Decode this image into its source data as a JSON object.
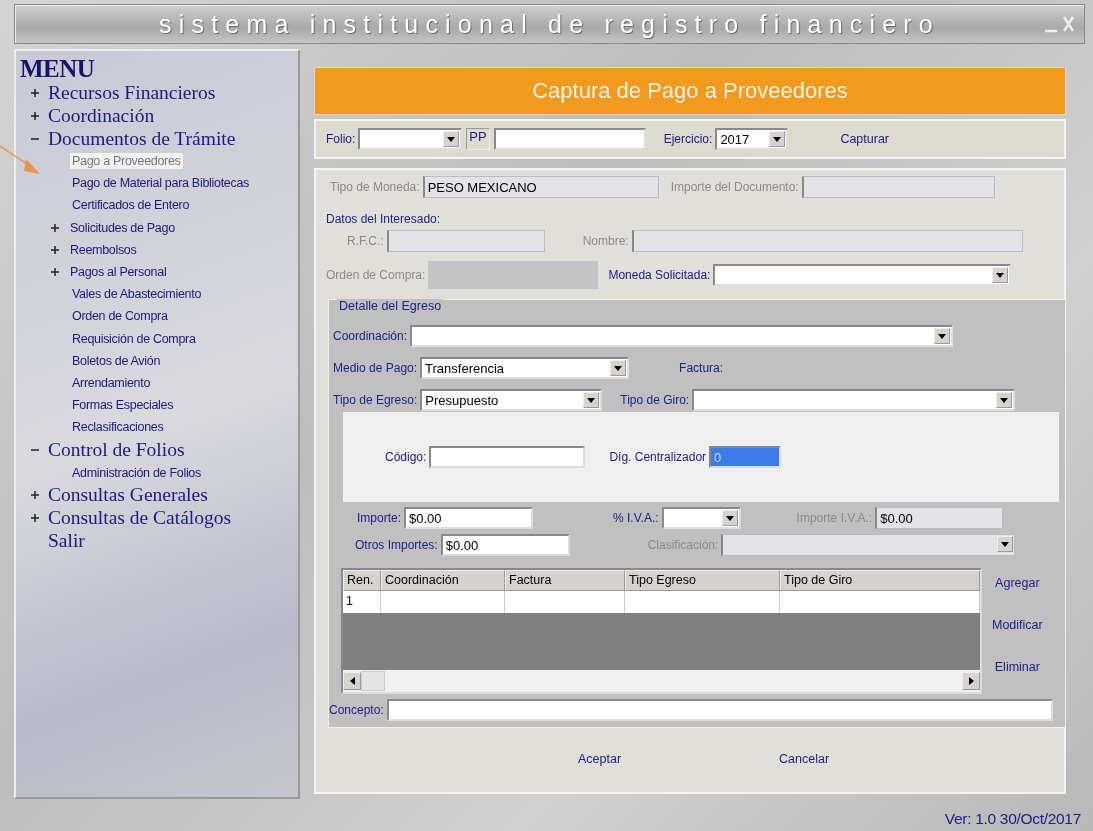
{
  "window": {
    "title": "sistema institucional de registro financiero"
  },
  "menu": {
    "title": "MENU",
    "items": [
      {
        "label": "Recursos Financieros",
        "kind": "folder",
        "expanded": false,
        "selected": false
      },
      {
        "label": "Coordinación",
        "kind": "folder",
        "expanded": false,
        "selected": false
      },
      {
        "label": "Documentos de Trámite",
        "kind": "folder",
        "expanded": true,
        "selected": false,
        "children": [
          {
            "label": "Pago a Proveedores",
            "kind": "leaf",
            "selected": true
          },
          {
            "label": "Pago de Material para Bibliotecas",
            "kind": "leaf",
            "selected": false
          },
          {
            "label": "Certificados de Entero",
            "kind": "leaf",
            "selected": false
          },
          {
            "label": "Solicitudes de Pago",
            "kind": "folder",
            "expanded": false,
            "selected": false
          },
          {
            "label": "Reembolsos",
            "kind": "folder",
            "expanded": false,
            "selected": false
          },
          {
            "label": "Pagos al Personal",
            "kind": "folder",
            "expanded": false,
            "selected": false
          },
          {
            "label": "Vales de Abastecimiento",
            "kind": "leaf",
            "selected": false
          },
          {
            "label": "Orden de Compra",
            "kind": "leaf",
            "selected": false
          },
          {
            "label": "Requisición de Compra",
            "kind": "leaf",
            "selected": false
          },
          {
            "label": "Boletos de Avión",
            "kind": "leaf",
            "selected": false
          },
          {
            "label": "Arrendamiento",
            "kind": "leaf",
            "selected": false
          },
          {
            "label": "Formas Especiales",
            "kind": "leaf",
            "selected": false
          },
          {
            "label": "Reclasificaciones",
            "kind": "leaf",
            "selected": false
          }
        ]
      },
      {
        "label": "Control de Folios",
        "kind": "folder",
        "expanded": true,
        "selected": false,
        "children": [
          {
            "label": "Administración de Folios",
            "kind": "leaf",
            "selected": false
          }
        ]
      },
      {
        "label": "Consultas Generales",
        "kind": "folder",
        "expanded": false,
        "selected": false
      },
      {
        "label": "Consultas de Catálogos",
        "kind": "folder",
        "expanded": false,
        "selected": false
      },
      {
        "label": "Salir",
        "kind": "leaf",
        "selected": false
      }
    ]
  },
  "form": {
    "title": "Captura de Pago a Proveedores",
    "toolbar": {
      "folio": {
        "label": "Folio:",
        "kind": "select",
        "disabled": false
      },
      "prefix": "PP",
      "number": {
        "kind": "text",
        "disabled": false
      },
      "ejercicio": {
        "label": "Ejercicio:",
        "kind": "select",
        "value": "2017",
        "disabled": false
      },
      "action": "Capturar"
    },
    "tipo_moneda": {
      "label": "Tipo de Moneda:",
      "kind": "text",
      "value": "PESO MEXICANO",
      "disabled": true
    },
    "importe_documento": {
      "label": "Importe del Documento:",
      "kind": "text",
      "disabled": true
    },
    "datos_interesado": "Datos del Interesado:",
    "rfc": {
      "label": "R.F.C.:",
      "kind": "text",
      "disabled": true
    },
    "nombre": {
      "label": "Nombre:",
      "kind": "text",
      "disabled": true
    },
    "orden_compra": {
      "label": "Orden de Compra:",
      "kind": "block",
      "disabled": true
    },
    "moneda_solicitada": {
      "label": "Moneda Solicitada:",
      "kind": "select",
      "disabled": false
    },
    "detalle": {
      "title": "Detalle del Egreso",
      "coordinacion": {
        "label": "Coordinación:",
        "kind": "select",
        "disabled": false
      },
      "medio_pago": {
        "label": "Medio de Pago:",
        "kind": "select",
        "value": "Transferencia",
        "disabled": false
      },
      "factura": "Factura:",
      "tipo_egreso": {
        "label": "Tipo de Egreso:",
        "kind": "select",
        "value": "Presupuesto",
        "disabled": false
      },
      "tipo_giro": {
        "label": "Tipo de Giro:",
        "kind": "select",
        "disabled": false
      },
      "codigo": {
        "label": "Código:",
        "kind": "text",
        "disabled": false
      },
      "centralizador": {
        "label": "Díg. Centralizador",
        "kind": "text",
        "value": "0",
        "disabled": false,
        "highlighted": true
      },
      "importe": {
        "label": "Importe:",
        "kind": "text",
        "value": "$0.00",
        "disabled": false
      },
      "iva": {
        "label": "% I.V.A.:",
        "kind": "select",
        "disabled": false
      },
      "importe_iva": {
        "label": "Importe I.V.A.:",
        "kind": "text",
        "value": "$0.00",
        "disabled": true
      },
      "otros_importes": {
        "label": "Otros Importes:",
        "kind": "text",
        "value": "$0.00",
        "disabled": false
      },
      "clasificacion": {
        "label": "Clasificación:",
        "kind": "select",
        "disabled": true
      },
      "table": {
        "columns": [
          "Ren.",
          "Coordinación",
          "Factura",
          "Tipo Egreso",
          "Tipo de Giro"
        ],
        "rows": [
          {
            "cells": [
              "1"
            ]
          }
        ]
      },
      "actions": [
        "Agregar",
        "Modificar",
        "Eliminar"
      ],
      "concepto": {
        "label": "Concepto:",
        "kind": "text",
        "disabled": false
      }
    },
    "buttons": [
      "Aceptar",
      "Cancelar"
    ]
  },
  "status_bar": {
    "version": "Ver: 1.0 30/Oct/2017"
  }
}
